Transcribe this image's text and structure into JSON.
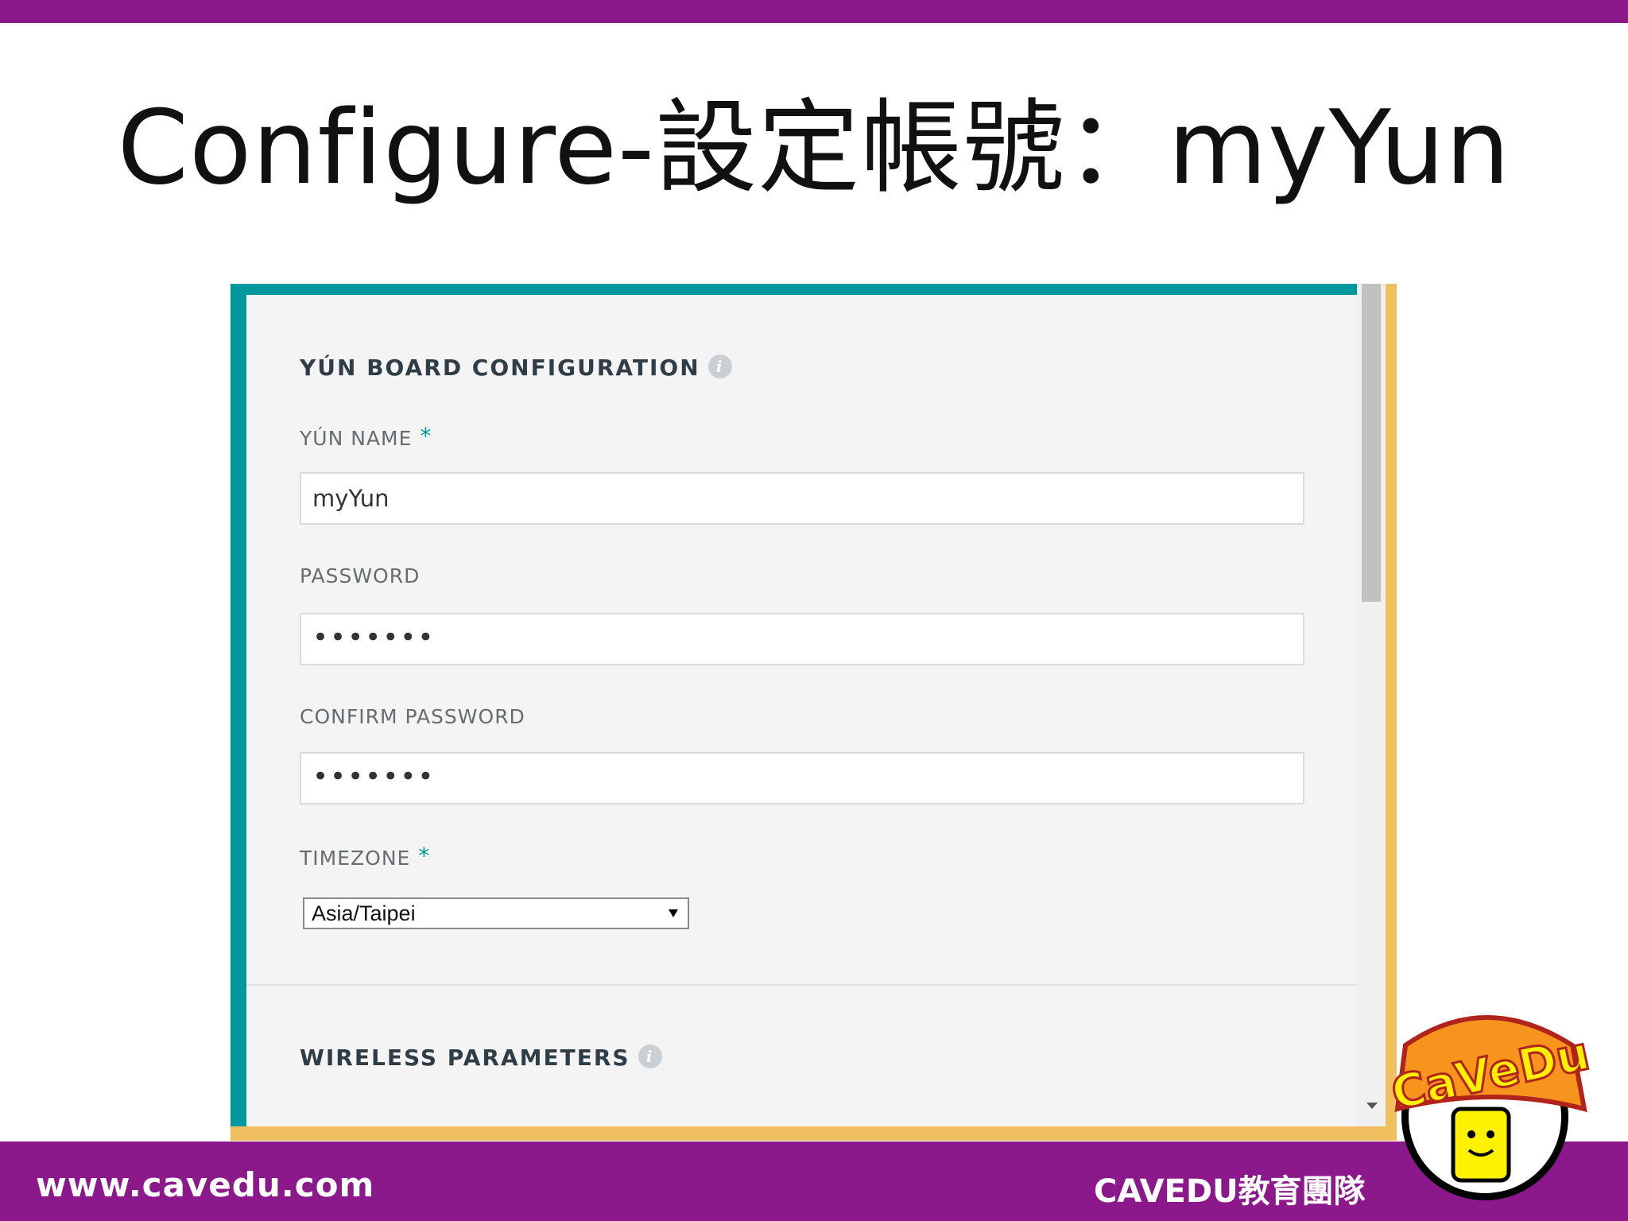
{
  "slide": {
    "title": "Configure-設定帳號：myYun",
    "footer_url": "www.cavedu.com",
    "footer_brand": "CAVEDU教育團隊",
    "logo_text": "CaVeDu"
  },
  "form": {
    "section1_title": "YÚN BOARD CONFIGURATION",
    "info_glyph": "i",
    "yun_name_label": "YÚN NAME",
    "yun_name_value": "myYun",
    "password_label": "PASSWORD",
    "password_value": "•••••••",
    "confirm_label": "CONFIRM PASSWORD",
    "confirm_value": "•••••••",
    "timezone_label": "TIMEZONE",
    "timezone_value": "Asia/Taipei",
    "required_mark": "*",
    "section2_title": "WIRELESS PARAMETERS"
  },
  "colors": {
    "slide_bar": "#8c198c",
    "panel_teal": "#00979d",
    "panel_gold": "#f0c060"
  },
  "icons": {
    "info": "info-icon",
    "select_arrow": "chevron-down-icon",
    "scroll_down": "scroll-down-arrow-icon"
  }
}
